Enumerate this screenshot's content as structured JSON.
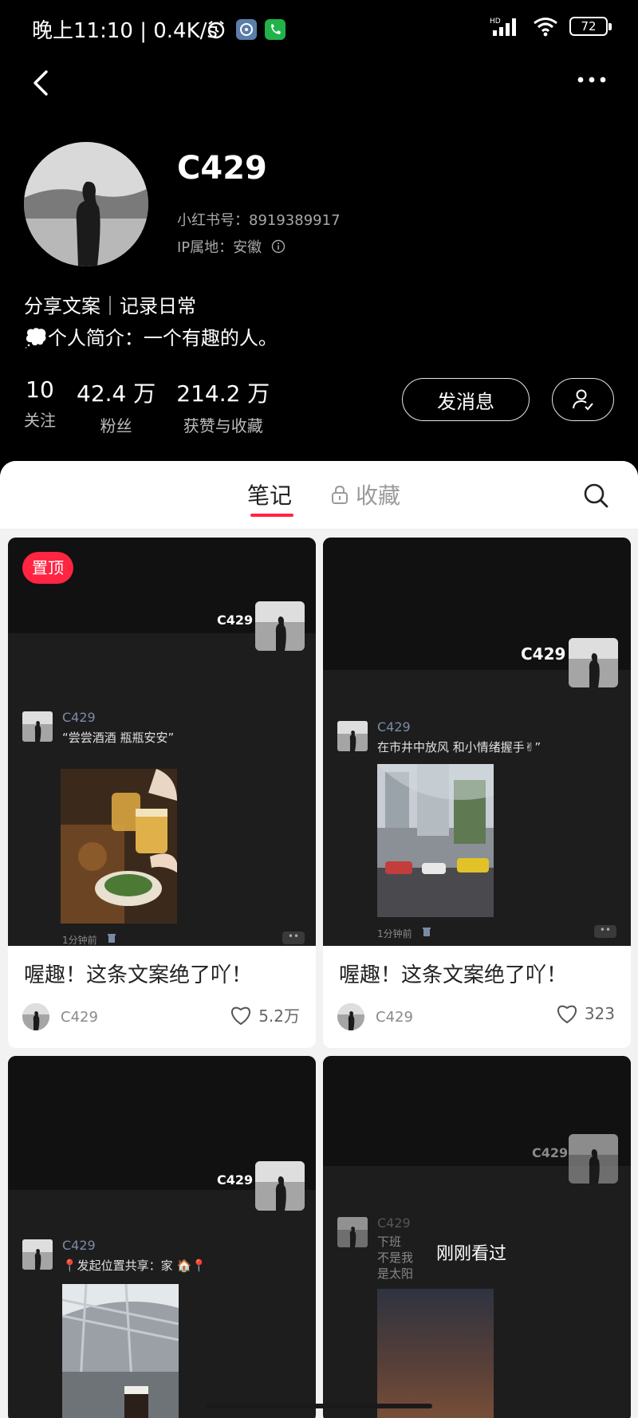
{
  "status_bar": {
    "time": "晚上11:10 | 0.4K/s",
    "network_badge": "HD",
    "battery": "72"
  },
  "profile": {
    "username": "C429",
    "id_line": "小红书号：8919389917",
    "ip_line": "IP属地：安徽",
    "bio_line1": "分享文案｜记录日常",
    "bio_line2": "💭个人简介：一个有趣的人。",
    "stats": [
      {
        "value": "10",
        "label": "关注"
      },
      {
        "value": "42.4 万",
        "label": "粉丝"
      },
      {
        "value": "214.2 万",
        "label": "获赞与收藏"
      }
    ],
    "message_button": "发消息"
  },
  "tabs": {
    "notes": "笔记",
    "favorites": "收藏"
  },
  "accent_color": "#ff2442",
  "notes": [
    {
      "pin_label": "置顶",
      "cover_name": "C429",
      "inner_name": "C429",
      "inner_text": "“尝尝酒酒 瓶瓶安安”",
      "inner_time": "1分钟前",
      "title": "喔趣！这条文案绝了吖！",
      "author": "C429",
      "likes": "5.2万"
    },
    {
      "cover_name": "C429",
      "inner_name": "C429",
      "inner_text": "在市井中放风 和小情绪握手✌”",
      "inner_time": "1分钟前",
      "title": "喔趣！这条文案绝了吖！",
      "author": "C429",
      "likes": "323"
    },
    {
      "cover_name": "C429",
      "inner_name": "C429",
      "inner_text": "📍发起位置共享：家 🏠📍"
    },
    {
      "cover_name": "C429",
      "inner_name": "C429",
      "inner_text_lines": [
        "下班",
        "不是我",
        "是太阳"
      ],
      "seen_label": "刚刚看过"
    }
  ]
}
